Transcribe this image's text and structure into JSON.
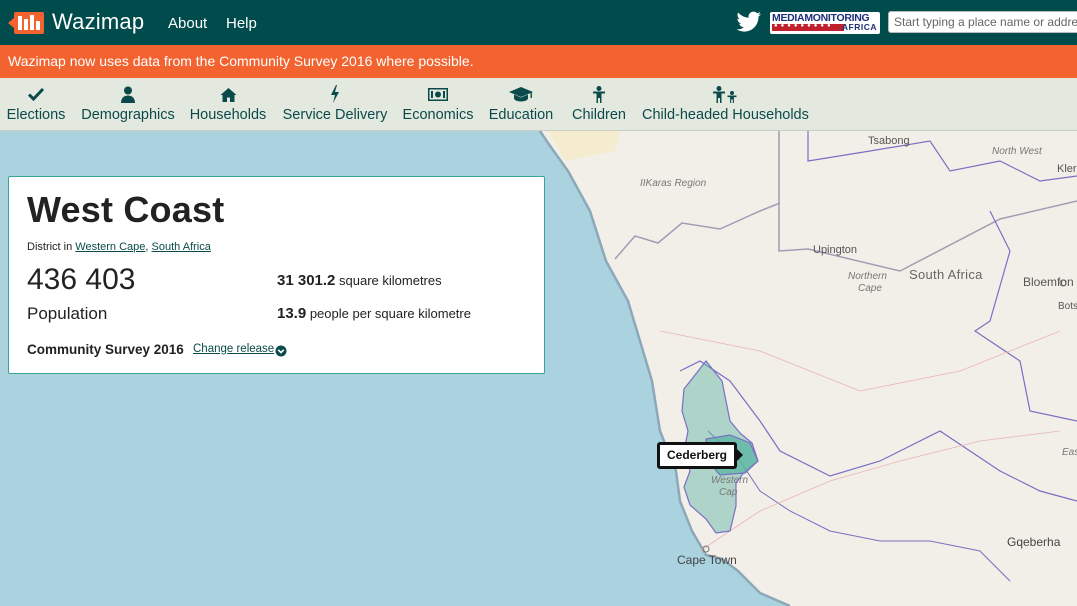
{
  "header": {
    "brand": "Wazimap",
    "nav": [
      {
        "label": "About"
      },
      {
        "label": "Help"
      }
    ],
    "search_placeholder": "Start typing a place name or address",
    "partner_logo": {
      "line1": "MEDIAMONITORING",
      "line2": "AFRICA"
    }
  },
  "banner": {
    "text": "Wazimap now uses data from the Community Survey 2016 where possible."
  },
  "categories": [
    {
      "label": "Elections",
      "icon": "check-icon"
    },
    {
      "label": "Demographics",
      "icon": "user-icon"
    },
    {
      "label": "Households",
      "icon": "home-icon"
    },
    {
      "label": "Service Delivery",
      "icon": "bolt-icon"
    },
    {
      "label": "Economics",
      "icon": "money-icon"
    },
    {
      "label": "Education",
      "icon": "graduation-cap-icon"
    },
    {
      "label": "Children",
      "icon": "child-icon"
    },
    {
      "label": "Child-headed Households",
      "icon": "child-household-icon"
    }
  ],
  "profile": {
    "title": "West Coast",
    "type_prefix": "District in",
    "parent": "Western Cape",
    "sep": ",",
    "country": "South Africa",
    "population": "436 403",
    "population_label": "Population",
    "area_value": "31 301.2",
    "area_unit": "square kilometres",
    "density_value": "13.9",
    "density_unit": "people per square kilometre",
    "release": "Community Survey 2016",
    "change_release": "Change release"
  },
  "map": {
    "tooltip": "Cederberg",
    "places": {
      "tsabong": "Tsabong",
      "north_west": "North West",
      "klerk": "Klerk",
      "karas": "IIKaras Region",
      "upington": "Upington",
      "northern": "Northern",
      "cape": "Cape",
      "south_africa": "South Africa",
      "bloemfon": "Bloemfon",
      "bots": "Bots",
      "western": "Western",
      "cape_small": "Cap",
      "cape_town": "Cape Town",
      "gqeberha": "Gqeberha",
      "east": "Eas"
    },
    "colors": {
      "sea": "#aad3df",
      "land": "#f2efe9",
      "region": "#5ab4a3",
      "border": "#7a6fc2"
    }
  }
}
